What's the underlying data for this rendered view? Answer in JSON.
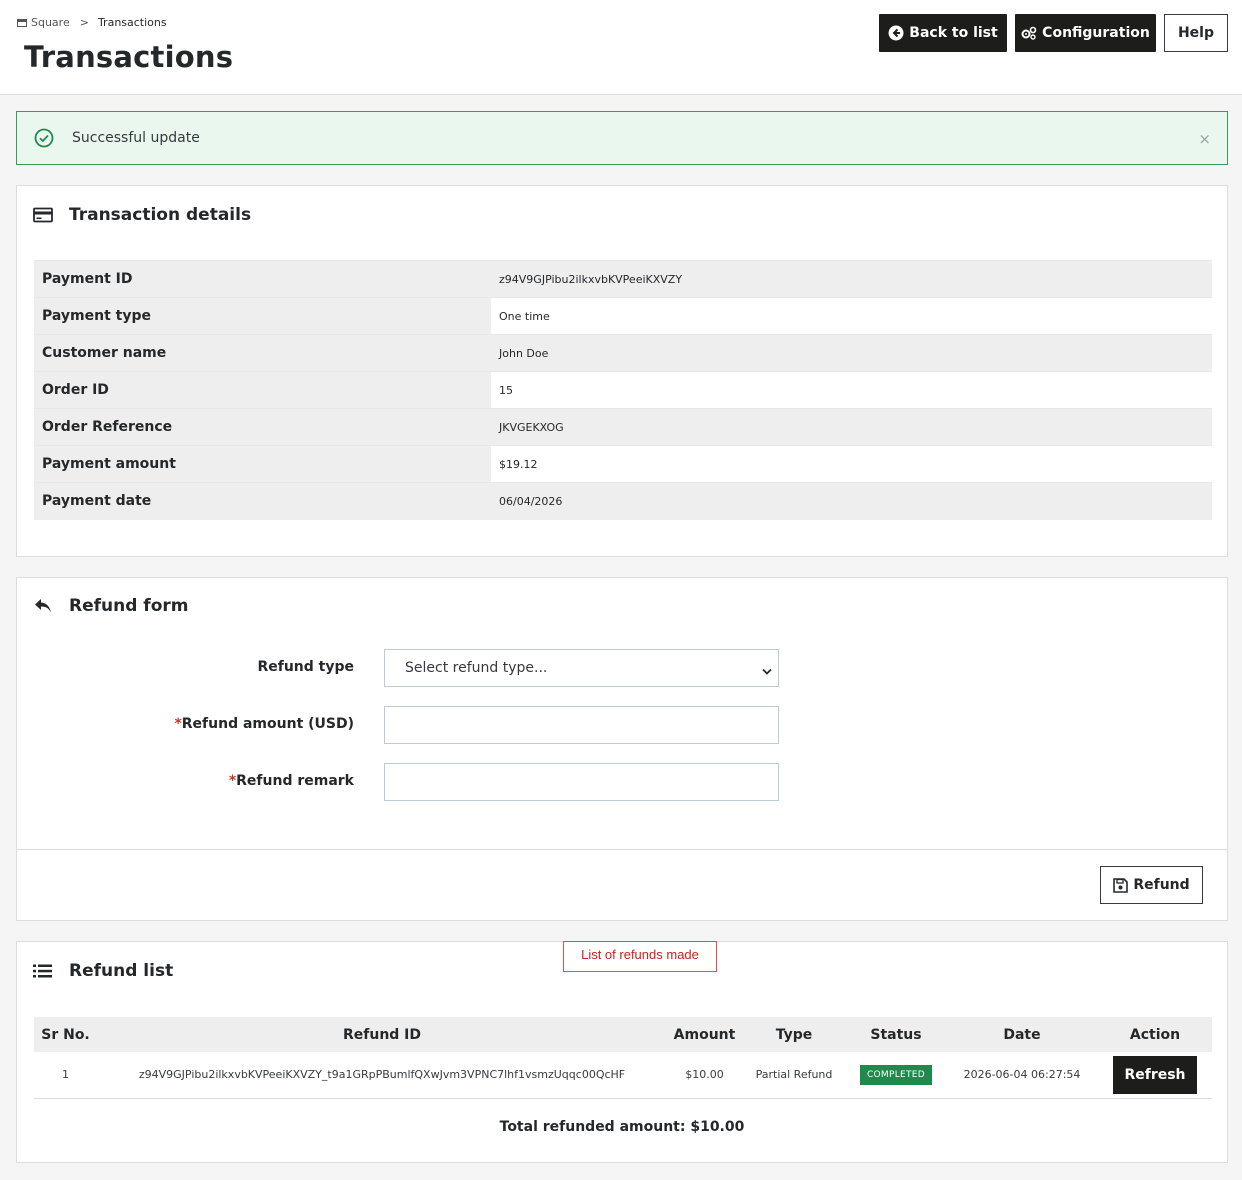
{
  "header": {
    "breadcrumb_root": "Square",
    "breadcrumb_sep": ">",
    "breadcrumb_current": "Transactions",
    "title": "Transactions",
    "back_label": "Back to list",
    "config_label": "Configuration",
    "help_label": "Help"
  },
  "alert": {
    "message": "Successful update",
    "close": "×"
  },
  "details": {
    "title": "Transaction details",
    "rows": [
      {
        "label": "Payment ID",
        "value": "z94V9GJPibu2ilkxvbKVPeeiKXVZY"
      },
      {
        "label": "Payment type",
        "value": "One time"
      },
      {
        "label": "Customer name",
        "value": "John Doe"
      },
      {
        "label": "Order ID",
        "value": "15"
      },
      {
        "label": "Order Reference",
        "value": "JKVGEKXOG"
      },
      {
        "label": "Payment amount",
        "value": "$19.12"
      },
      {
        "label": "Payment date",
        "value": "06/04/2026"
      }
    ]
  },
  "refund_form": {
    "title": "Refund form",
    "type_label": "Refund type",
    "type_value": "Select refund type...",
    "required_mark": "*",
    "amount_label": "Refund amount (USD)",
    "amount_value": "",
    "remark_label": "Refund remark",
    "remark_value": "",
    "submit_label": "Refund"
  },
  "annotation": "List of refunds made",
  "refund_list": {
    "title": "Refund list",
    "columns": [
      "Sr No.",
      "Refund ID",
      "Amount",
      "Type",
      "Status",
      "Date",
      "Action"
    ],
    "rows": [
      {
        "sr": "1",
        "refund_id": "z94V9GJPibu2ilkxvbKVPeeiKXVZY_t9a1GRpPBumlfQXwJvm3VPNC7lhf1vsmzUqqc00QcHF",
        "amount": "$10.00",
        "type": "Partial Refund",
        "status": "COMPLETED",
        "date": "2026-06-04 06:27:54",
        "action": "Refresh"
      }
    ],
    "total": "Total refunded amount: $10.00"
  },
  "colors": {
    "success": "#1e8a4c",
    "dark": "#1d1d1b",
    "annotation": "#cc1f1f"
  }
}
